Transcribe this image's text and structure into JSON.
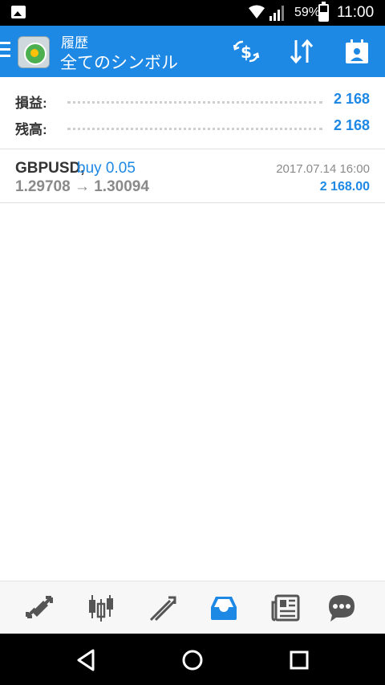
{
  "status_bar": {
    "battery_pct": "59%",
    "time": "11:00"
  },
  "app_bar": {
    "title": "履歴",
    "subtitle": "全てのシンボル",
    "icons": [
      "menu-icon",
      "app-logo",
      "currency-exchange-icon",
      "sort-icon",
      "calendar-icon"
    ]
  },
  "summary": {
    "rows": [
      {
        "label": "損益:",
        "value": "2 168"
      },
      {
        "label": "残高:",
        "value": "2 168"
      }
    ]
  },
  "trades": [
    {
      "symbol": "GBPUSD,",
      "direction": "buy 0.05",
      "prices": "1.29708 → 1.30094",
      "time": "2017.07.14 16:00",
      "profit": "2 168.00"
    }
  ],
  "bottom_nav": {
    "items": [
      "quotes-icon",
      "chart-icon",
      "trade-icon",
      "history-icon",
      "news-icon",
      "chat-icon"
    ],
    "active": "history-icon",
    "colors": {
      "active": "#1e88e5",
      "inactive": "#555555"
    }
  },
  "colors": {
    "primary": "#1e88e5",
    "positive_value": "#1e88e5",
    "muted_text": "#8a8a8a"
  }
}
